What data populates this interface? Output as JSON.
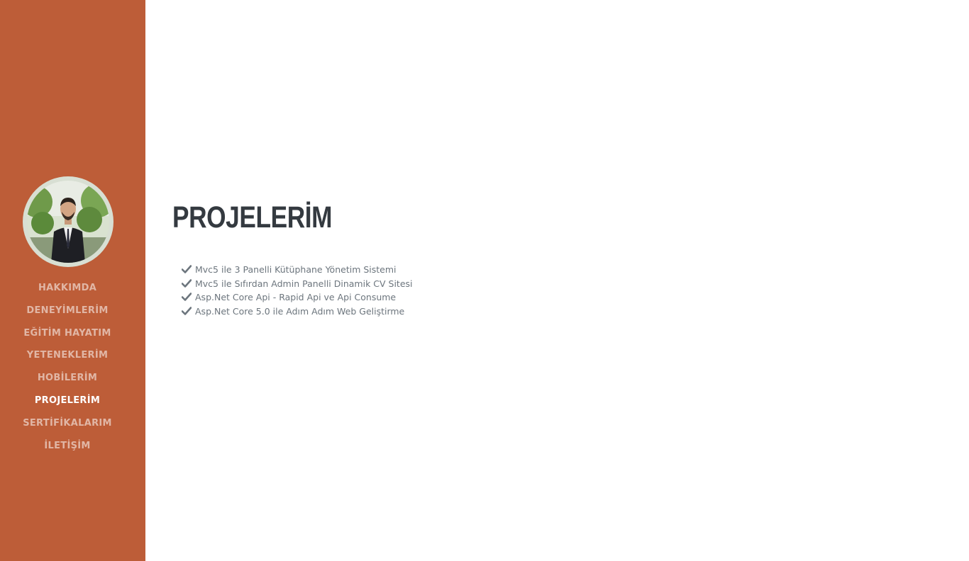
{
  "nav": {
    "items": [
      {
        "label": "HAKKIMDA"
      },
      {
        "label": "DENEYİMLERİM"
      },
      {
        "label": "EĞİTİM HAYATIM"
      },
      {
        "label": "YETENEKLERİM"
      },
      {
        "label": "HOBİLERİM"
      },
      {
        "label": "PROJELERİM",
        "active": true
      },
      {
        "label": "SERTİFİKALARIM"
      },
      {
        "label": "İLETİŞİM"
      }
    ]
  },
  "section": {
    "title": "PROJELERİM",
    "projects": [
      {
        "text": "Mvc5 ile 3 Panelli Kütüphane Yönetim Sistemi",
        "icon": "check-icon"
      },
      {
        "text": "Mvc5 ile Sıfırdan Admin Panelli Dinamik CV Sitesi",
        "icon": "check-icon"
      },
      {
        "text": "Asp.Net Core Api - Rapid Api ve Api Consume",
        "icon": "check-icon"
      },
      {
        "text": "Asp.Net Core 5.0 ile Adım Adım Web Geliştirme",
        "icon": "check-icon"
      }
    ]
  },
  "colors": {
    "sidebar": "#bd5d38",
    "title": "#343a40",
    "text": "#6c757d"
  }
}
